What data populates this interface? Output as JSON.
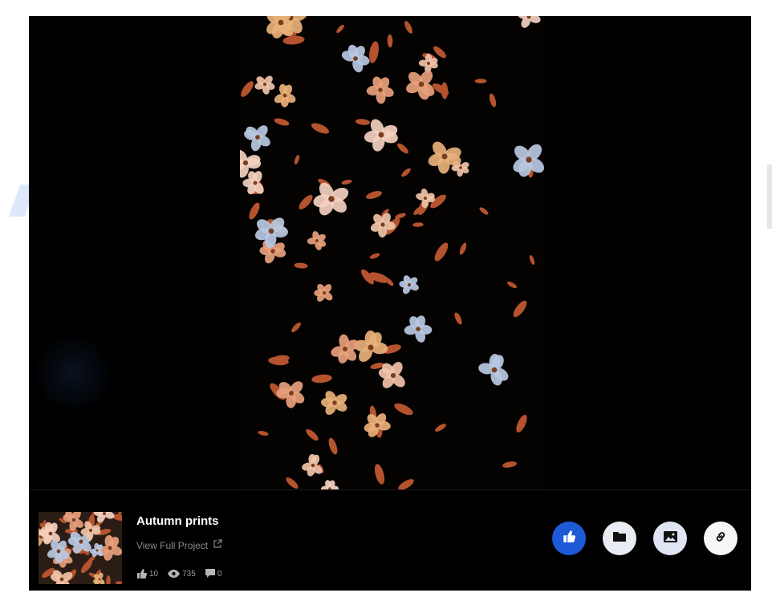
{
  "project": {
    "title": "Autumn prints",
    "view_full_label": "View Full Project"
  },
  "stats": {
    "appreciations": "10",
    "views": "735",
    "comments": "0"
  },
  "actions": [
    {
      "name": "like",
      "icon": "thumbs-up-icon",
      "color": "#1d5ad8"
    },
    {
      "name": "save-to-collection",
      "icon": "folder-icon",
      "color": "#e9ecf2"
    },
    {
      "name": "save-to-moodboard",
      "icon": "image-icon",
      "color": "#dfe5f3"
    },
    {
      "name": "copy-link",
      "icon": "link-icon",
      "color": "#f6f6f6"
    }
  ],
  "colors": {
    "background": "#000000",
    "accent": "#1d5ad8",
    "petal_peach": "#e8a07c",
    "petal_pale_blue": "#b9c8e2",
    "leaf_rust": "#b4532d"
  }
}
